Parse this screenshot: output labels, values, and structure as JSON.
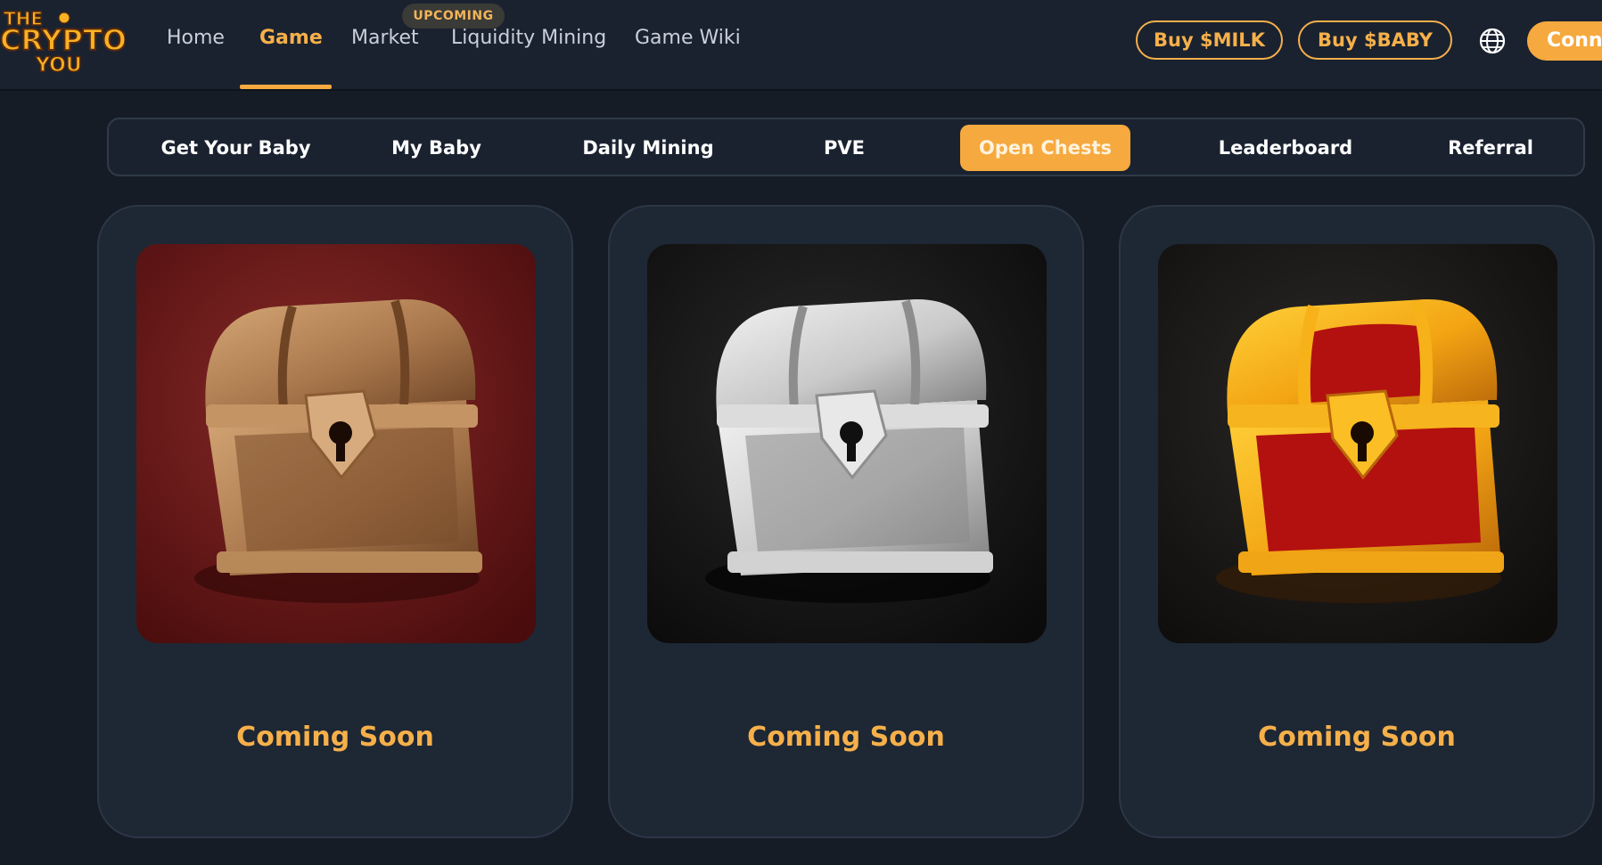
{
  "logo": {
    "line1": "THE",
    "line2": "CRYPTO",
    "line3": "YOU"
  },
  "nav": {
    "home": "Home",
    "game": "Game",
    "market": "Market",
    "liquidity_mining": "Liquidity Mining",
    "game_wiki": "Game Wiki",
    "upcoming_badge": "UPCOMING"
  },
  "actions": {
    "buy_milk": "Buy $MILK",
    "buy_baby": "Buy $BABY",
    "connect": "Conne"
  },
  "tabs": [
    {
      "label": "Get Your Baby"
    },
    {
      "label": "My Baby"
    },
    {
      "label": "Daily Mining"
    },
    {
      "label": "PVE"
    },
    {
      "label": "Open Chests"
    },
    {
      "label": "Leaderboard"
    },
    {
      "label": "Referral"
    }
  ],
  "active_tab": "Open Chests",
  "chests": [
    {
      "variant": "bronze",
      "status": "Coming Soon"
    },
    {
      "variant": "silver",
      "status": "Coming Soon"
    },
    {
      "variant": "gold",
      "status": "Coming Soon"
    }
  ],
  "colors": {
    "accent": "#f6a93e",
    "background": "#151c26",
    "card": "#1e2734"
  }
}
